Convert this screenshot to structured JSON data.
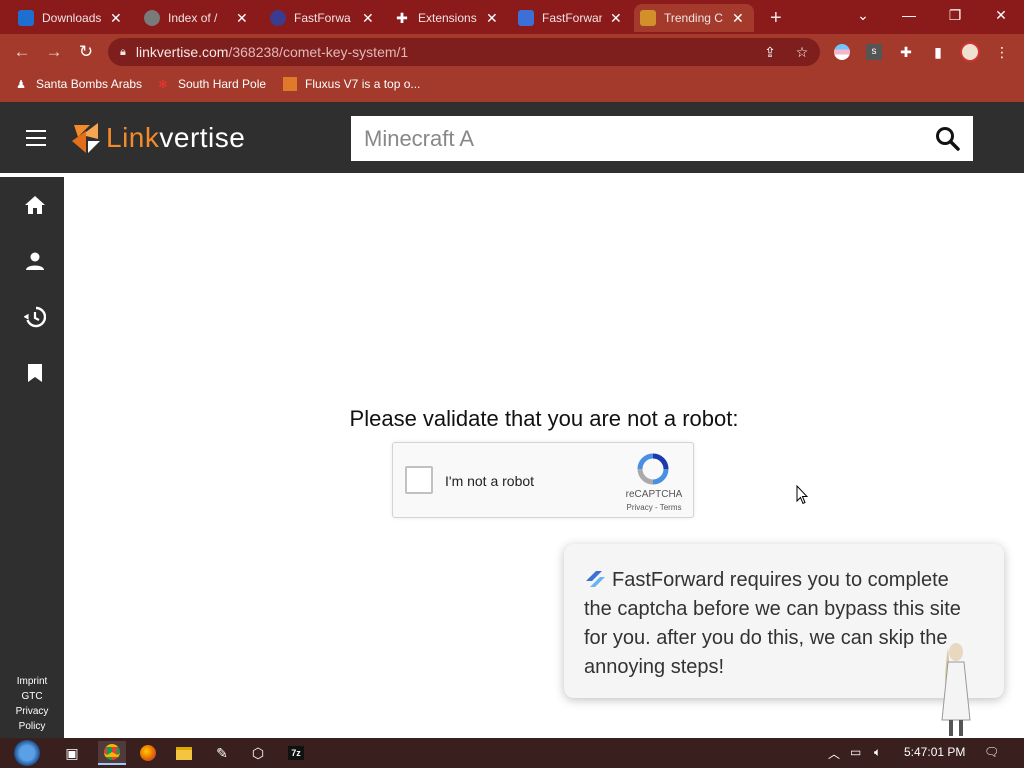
{
  "browser": {
    "tabs": [
      {
        "title": "Downloads",
        "favicon_color": "#1f6fd1"
      },
      {
        "title": "Index of /",
        "favicon_color": "#7a7a7a"
      },
      {
        "title": "FastForwa",
        "favicon_color": "#3b3b8f"
      },
      {
        "title": "Extensions",
        "favicon_color": "#ffffff"
      },
      {
        "title": "FastForwar",
        "favicon_color": "#3d6fd6"
      },
      {
        "title": "Trending C",
        "favicon_color": "#d1902a"
      }
    ],
    "new_tab_label": "+",
    "url_host": "linkvertise.com",
    "url_path": "/368238/comet-key-system/1",
    "bookmarks": [
      "Santa Bombs Arabs",
      "South Hard Pole",
      "Fluxus V7 is a top o..."
    ]
  },
  "site": {
    "logo_link": "Link",
    "logo_rest": "vertise",
    "search_value": "Minecraft A",
    "nav_icons": [
      "home-icon",
      "person-icon",
      "history-icon",
      "bookmark-icon"
    ],
    "footer_links": [
      "Imprint",
      "GTC",
      "Privacy",
      "Policy"
    ]
  },
  "main": {
    "heading": "Please validate that you are not a robot:",
    "recaptcha": {
      "label": "I'm not a robot",
      "brand": "reCAPTCHA",
      "links": "Privacy - Terms"
    }
  },
  "toast": {
    "message": "FastForward requires you to complete the captcha before we can bypass this site for you. after you do this, we can skip the annoying steps!"
  },
  "taskbar": {
    "time": "5:47:01 PM"
  },
  "colors": {
    "chrome_dark": "#8b1a1a",
    "chrome": "#a33a2c",
    "site_header": "#2f2f2f",
    "accent_orange": "#f48b2a"
  }
}
